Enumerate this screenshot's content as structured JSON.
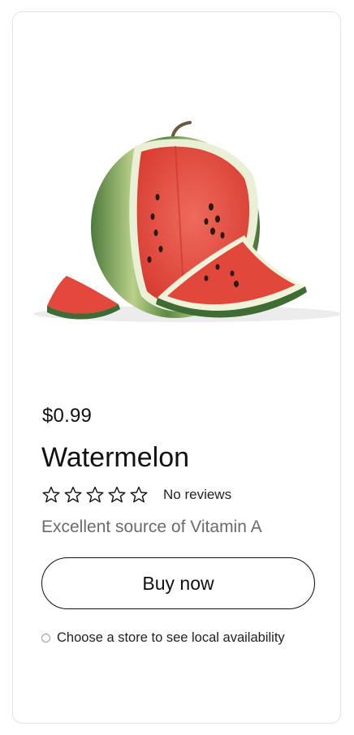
{
  "product": {
    "image_alt": "Watermelon",
    "price": "$0.99",
    "title": "Watermelon",
    "rating": 0,
    "rating_max": 5,
    "reviews_text": "No reviews",
    "description": "Excellent source of Vitamin A",
    "buy_label": "Buy now",
    "store_prompt": "Choose a store to see local availability"
  },
  "colors": {
    "rind_dark": "#3f6b34",
    "rind_light": "#a8c57a",
    "flesh": "#e0493d",
    "text_muted": "#6b6b6b",
    "border": "#e3e3e3"
  }
}
